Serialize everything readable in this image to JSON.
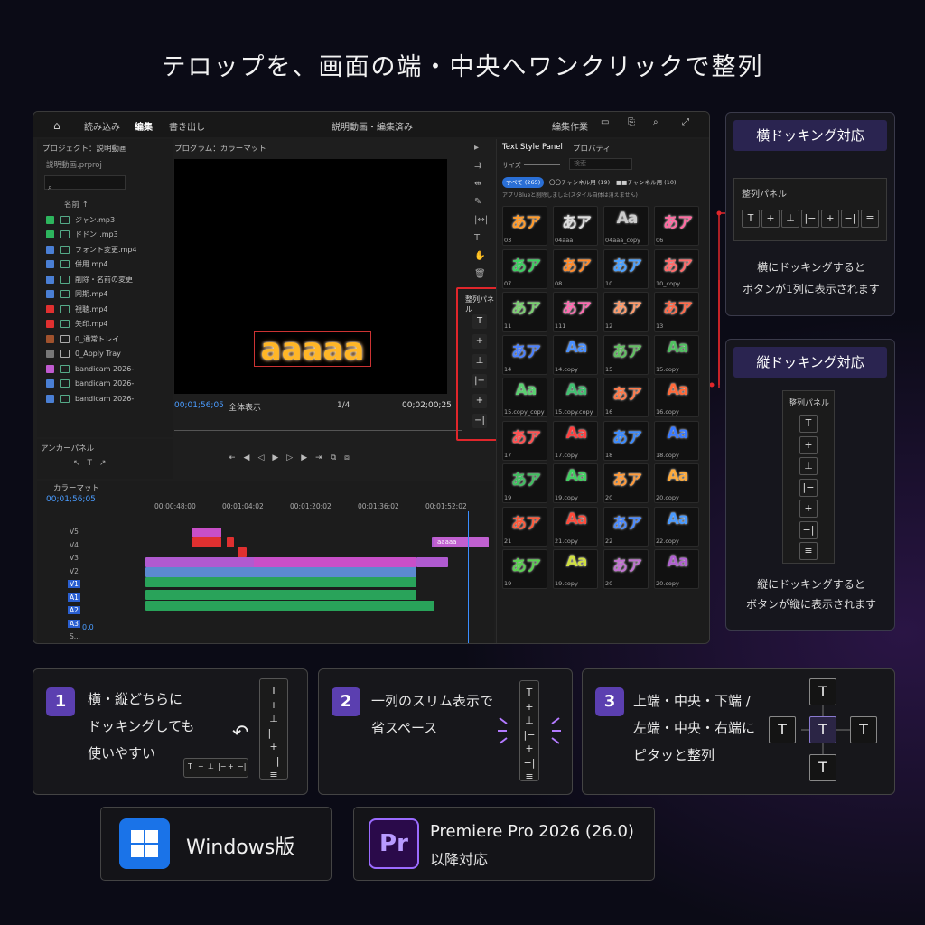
{
  "headline": "テロップを、画面の端・中央へワンクリックで整列",
  "app": {
    "tabs": [
      "読み込み",
      "編集",
      "書き出し"
    ],
    "title": "説明動画・編集済み",
    "workspace": "編集作業",
    "project_title": "プロジェクト：説明動画",
    "project_file": "説明動画.prproj",
    "name_col": "名前 ↑",
    "items": [
      {
        "label": "ジャン.mp3",
        "color": "#2db55d",
        "type": "audio"
      },
      {
        "label": "ドドン!.mp3",
        "color": "#2db55d",
        "type": "audio"
      },
      {
        "label": "フォント変更.mp4",
        "color": "#4a7fd4",
        "type": "video"
      },
      {
        "label": "併用.mp4",
        "color": "#4a7fd4",
        "type": "video"
      },
      {
        "label": "削除・名前の変更",
        "color": "#4a7fd4",
        "type": "video"
      },
      {
        "label": "同期.mp4",
        "color": "#4a7fd4",
        "type": "video"
      },
      {
        "label": "視聴.mp4",
        "color": "#e03030",
        "type": "video"
      },
      {
        "label": "矢印.mp4",
        "color": "#e03030",
        "type": "video"
      },
      {
        "label": "0_通常トレイ",
        "color": "#a0522d",
        "type": "folder"
      },
      {
        "label": "0_Apply Tray",
        "color": "#777777",
        "type": "folder"
      },
      {
        "label": "bandicam 2026-",
        "color": "#c05ad0",
        "type": "video"
      },
      {
        "label": "bandicam 2026-",
        "color": "#4a7fd4",
        "type": "video"
      },
      {
        "label": "bandicam 2026-",
        "color": "#4a7fd4",
        "type": "video"
      }
    ],
    "anchor_panel": "アンカーパネル",
    "program_title": "プログラム：カラーマット",
    "screen_text": "aaaaa",
    "timecode_left": "00;01;56;05",
    "fit": "全体表示",
    "quality": "1/4",
    "timecode_right": "00;02;00;25",
    "align_panel_label": "整列パネル",
    "align_buttons": [
      "T",
      "+",
      "⊥",
      "|−",
      "+",
      "−|",
      "≡"
    ],
    "tsp": {
      "tab1": "Text Style Panel",
      "tab2": "プロパティ",
      "size_label": "サイズ",
      "search_placeholder": "検索",
      "filter_all": "すべて (265)",
      "filter_a": "〇〇チャンネル用 (19)",
      "filter_b": "■■チャンネル用 (10)",
      "note": "アプリBlueと削除しました(スタイル自体は消えません)"
    },
    "tiles": [
      {
        "t": "あア",
        "l": "03",
        "c": "#ff9a2a"
      },
      {
        "t": "あア",
        "l": "04aaa",
        "c": "#dddddd"
      },
      {
        "t": "Aa",
        "l": "04aaa_copy",
        "c": "#cccccc"
      },
      {
        "t": "あア",
        "l": "06",
        "c": "#ff6aa0"
      },
      {
        "t": "あア",
        "l": "07",
        "c": "#3cd060"
      },
      {
        "t": "あア",
        "l": "08",
        "c": "#ff8a2a"
      },
      {
        "t": "あア",
        "l": "10",
        "c": "#4aa0ff"
      },
      {
        "t": "あア",
        "l": "10_copy",
        "c": "#ff6a6a"
      },
      {
        "t": "あア",
        "l": "11",
        "c": "#7ad070"
      },
      {
        "t": "あア",
        "l": "111",
        "c": "#ff6ab0"
      },
      {
        "t": "あア",
        "l": "12",
        "c": "#ff9a6a"
      },
      {
        "t": "あア",
        "l": "13",
        "c": "#ff6a4a"
      },
      {
        "t": "あア",
        "l": "14",
        "c": "#4a80ff"
      },
      {
        "t": "Aa",
        "l": "14.copy",
        "c": "#4a90ff"
      },
      {
        "t": "あア",
        "l": "15",
        "c": "#60c060"
      },
      {
        "t": "Aa",
        "l": "15.copy",
        "c": "#50c060"
      },
      {
        "t": "Aa",
        "l": "15.copy_copy",
        "c": "#5ad070"
      },
      {
        "t": "Aa",
        "l": "15.copy.copy",
        "c": "#40c070"
      },
      {
        "t": "あア",
        "l": "16",
        "c": "#ff7a4a"
      },
      {
        "t": "Aa",
        "l": "16.copy",
        "c": "#ff6a3a"
      },
      {
        "t": "あア",
        "l": "17",
        "c": "#ff5050"
      },
      {
        "t": "Aa",
        "l": "17.copy",
        "c": "#ff4040"
      },
      {
        "t": "あア",
        "l": "18",
        "c": "#3a8aff"
      },
      {
        "t": "Aa",
        "l": "18.copy",
        "c": "#3a7aff"
      },
      {
        "t": "あア",
        "l": "19",
        "c": "#40c060"
      },
      {
        "t": "Aa",
        "l": "19.copy",
        "c": "#40d060"
      },
      {
        "t": "あア",
        "l": "20",
        "c": "#ff9a3a"
      },
      {
        "t": "Aa",
        "l": "20.copy",
        "c": "#ffaa3a"
      },
      {
        "t": "あア",
        "l": "21",
        "c": "#ff5a3a"
      },
      {
        "t": "Aa",
        "l": "21.copy",
        "c": "#ff4a3a"
      },
      {
        "t": "あア",
        "l": "22",
        "c": "#4a8aff"
      },
      {
        "t": "Aa",
        "l": "22.copy",
        "c": "#4a9aff"
      },
      {
        "t": "あア",
        "l": "19",
        "c": "#5ad050"
      },
      {
        "t": "Aa",
        "l": "19.copy",
        "c": "#d0e040"
      },
      {
        "t": "あア",
        "l": "20",
        "c": "#c070d0"
      },
      {
        "t": "Aa",
        "l": "20.copy",
        "c": "#b060d0"
      }
    ],
    "seq_name": "カラーマット",
    "seq_time": "00;01;56;05",
    "ruler": [
      "00:00:48:00",
      "00:01:04:02",
      "00:01:20:02",
      "00:01:36:02",
      "00:01:52:02"
    ],
    "tracks": [
      "V5",
      "V4",
      "V3",
      "V2",
      "V1",
      "A1",
      "A2",
      "A3",
      "S..."
    ],
    "gain": "0.0",
    "clip_text": "aaaaa"
  },
  "horizontal": {
    "title": "横ドッキング対応",
    "panel": "整列パネル",
    "buttons": [
      "T",
      "+",
      "⊥",
      "|−",
      "+",
      "−|",
      "≡"
    ],
    "desc1": "横にドッキングすると",
    "desc2": "ボタンが1列に表示されます"
  },
  "vertical": {
    "title": "縦ドッキング対応",
    "panel": "整列パネル",
    "buttons": [
      "T",
      "+",
      "⊥",
      "|−",
      "+",
      "−|",
      "≡"
    ],
    "desc1": "縦にドッキングすると",
    "desc2": "ボタンが縦に表示されます"
  },
  "cards": [
    {
      "num": "1",
      "lines": [
        "横・縦どちらに",
        "ドッキングしても",
        "使いやすい"
      ]
    },
    {
      "num": "2",
      "lines": [
        "一列のスリム表示で",
        "省スペース"
      ]
    },
    {
      "num": "3",
      "lines": [
        "上端・中央・下端 /",
        "左端・中央・右端に",
        "ピタッと整列"
      ]
    }
  ],
  "mini_buttons": [
    "T",
    "+",
    "⊥",
    "|−",
    "+",
    "−|",
    "≡"
  ],
  "windows_label": "Windows版",
  "premiere": {
    "badge": "Pr",
    "line1": "Premiere Pro 2026 (26.0)",
    "line2": "以降対応"
  },
  "t_glyph": "T"
}
